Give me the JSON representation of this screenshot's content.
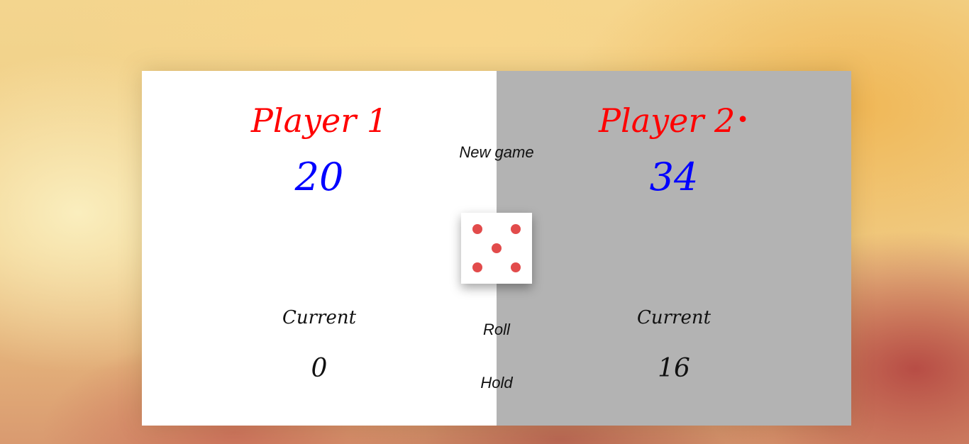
{
  "players": [
    {
      "name": "Player 1",
      "score": "20",
      "current_label": "Current",
      "current_score": "0",
      "active": false
    },
    {
      "name": "Player 2",
      "score": "34",
      "current_label": "Current",
      "current_score": "16",
      "active": true,
      "active_marker": "•"
    }
  ],
  "controls": {
    "new_game_label": "New game",
    "roll_label": "Roll",
    "hold_label": "Hold"
  },
  "dice": {
    "value": 5,
    "pip_color": "#e24b4b"
  },
  "colors": {
    "name": "#ff0000",
    "score": "#0000ff",
    "active_panel_bg": "#b3b3b3",
    "inactive_panel_bg": "#ffffff"
  }
}
